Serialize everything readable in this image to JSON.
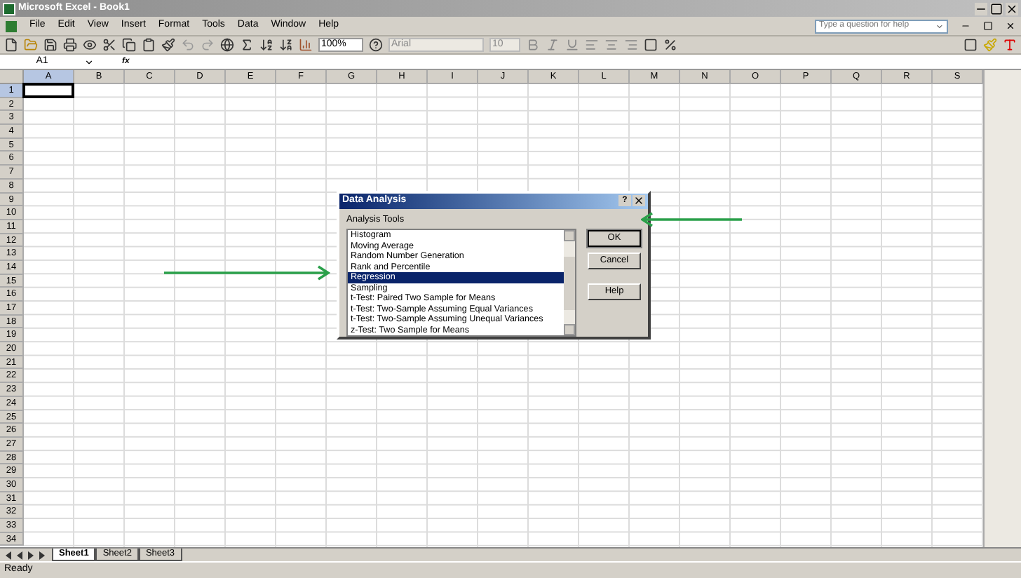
{
  "window": {
    "title": "Microsoft Excel - Book1"
  },
  "menu": [
    "File",
    "Edit",
    "View",
    "Insert",
    "Format",
    "Tools",
    "Data",
    "Window",
    "Help"
  ],
  "help_box": {
    "placeholder": "Type a question for help"
  },
  "toolbar": {
    "zoom": "100%",
    "font": "Arial",
    "font_size": "10"
  },
  "formula_bar": {
    "name_box": "A1",
    "fx": "fx"
  },
  "columns": [
    {
      "label": "A",
      "selected": true
    },
    {
      "label": "B",
      "selected": false
    },
    {
      "label": "C",
      "selected": false
    },
    {
      "label": "D",
      "selected": false
    },
    {
      "label": "E",
      "selected": false
    },
    {
      "label": "F",
      "selected": false
    },
    {
      "label": "G",
      "selected": false
    },
    {
      "label": "H",
      "selected": false
    },
    {
      "label": "I",
      "selected": false
    },
    {
      "label": "J",
      "selected": false
    },
    {
      "label": "K",
      "selected": false
    },
    {
      "label": "L",
      "selected": false
    },
    {
      "label": "M",
      "selected": false
    },
    {
      "label": "N",
      "selected": false
    },
    {
      "label": "O",
      "selected": false
    },
    {
      "label": "P",
      "selected": false
    },
    {
      "label": "Q",
      "selected": false
    },
    {
      "label": "R",
      "selected": false
    },
    {
      "label": "S",
      "selected": false
    }
  ],
  "rows": [
    {
      "label": "1",
      "selected": true
    },
    {
      "label": "2",
      "selected": false
    },
    {
      "label": "3",
      "selected": false
    },
    {
      "label": "4",
      "selected": false
    },
    {
      "label": "5",
      "selected": false
    },
    {
      "label": "6",
      "selected": false
    },
    {
      "label": "7",
      "selected": false
    },
    {
      "label": "8",
      "selected": false
    },
    {
      "label": "9",
      "selected": false
    },
    {
      "label": "10",
      "selected": false
    },
    {
      "label": "11",
      "selected": false
    },
    {
      "label": "12",
      "selected": false
    },
    {
      "label": "13",
      "selected": false
    },
    {
      "label": "14",
      "selected": false
    },
    {
      "label": "15",
      "selected": false
    },
    {
      "label": "16",
      "selected": false
    },
    {
      "label": "17",
      "selected": false
    },
    {
      "label": "18",
      "selected": false
    },
    {
      "label": "19",
      "selected": false
    },
    {
      "label": "20",
      "selected": false
    },
    {
      "label": "21",
      "selected": false
    },
    {
      "label": "22",
      "selected": false
    },
    {
      "label": "23",
      "selected": false
    },
    {
      "label": "24",
      "selected": false
    },
    {
      "label": "25",
      "selected": false
    },
    {
      "label": "26",
      "selected": false
    },
    {
      "label": "27",
      "selected": false
    },
    {
      "label": "28",
      "selected": false
    },
    {
      "label": "29",
      "selected": false
    },
    {
      "label": "30",
      "selected": false
    },
    {
      "label": "31",
      "selected": false
    },
    {
      "label": "32",
      "selected": false
    },
    {
      "label": "33",
      "selected": false
    },
    {
      "label": "34",
      "selected": false
    }
  ],
  "sheet_tabs": [
    {
      "label": "Sheet1",
      "selected": true
    },
    {
      "label": "Sheet2",
      "selected": false
    },
    {
      "label": "Sheet3",
      "selected": false
    }
  ],
  "status_bar": {
    "text": "Ready"
  },
  "dialog": {
    "title": "Data Analysis",
    "help_button": "?",
    "list_label": "Analysis Tools",
    "items": [
      {
        "label": "Histogram",
        "selected": false
      },
      {
        "label": "Moving Average",
        "selected": false
      },
      {
        "label": "Random Number Generation",
        "selected": false
      },
      {
        "label": "Rank and Percentile",
        "selected": false
      },
      {
        "label": "Regression",
        "selected": true
      },
      {
        "label": "Sampling",
        "selected": false
      },
      {
        "label": "t-Test: Paired Two Sample for Means",
        "selected": false
      },
      {
        "label": "t-Test: Two-Sample Assuming Equal Variances",
        "selected": false
      },
      {
        "label": "t-Test: Two-Sample Assuming Unequal Variances",
        "selected": false
      },
      {
        "label": "z-Test: Two Sample for Means",
        "selected": false
      }
    ],
    "buttons": [
      {
        "label": "OK",
        "kind": "default"
      },
      {
        "label": "Cancel",
        "kind": "normal"
      },
      {
        "label": "Help",
        "kind": "normal"
      }
    ]
  }
}
